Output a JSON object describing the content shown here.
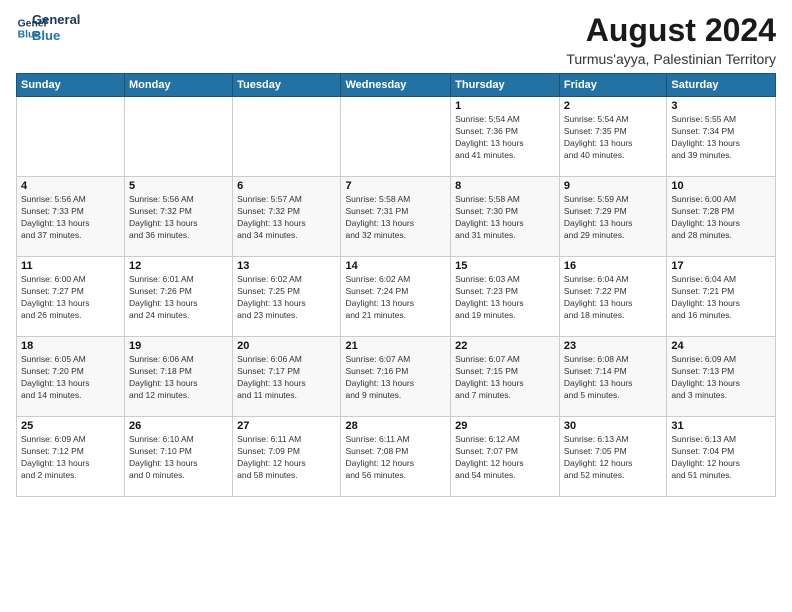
{
  "header": {
    "logo_line1": "General",
    "logo_line2": "Blue",
    "main_title": "August 2024",
    "subtitle": "Turmus'ayya, Palestinian Territory"
  },
  "weekdays": [
    "Sunday",
    "Monday",
    "Tuesday",
    "Wednesday",
    "Thursday",
    "Friday",
    "Saturday"
  ],
  "weeks": [
    [
      {
        "day": "",
        "info": ""
      },
      {
        "day": "",
        "info": ""
      },
      {
        "day": "",
        "info": ""
      },
      {
        "day": "",
        "info": ""
      },
      {
        "day": "1",
        "info": "Sunrise: 5:54 AM\nSunset: 7:36 PM\nDaylight: 13 hours\nand 41 minutes."
      },
      {
        "day": "2",
        "info": "Sunrise: 5:54 AM\nSunset: 7:35 PM\nDaylight: 13 hours\nand 40 minutes."
      },
      {
        "day": "3",
        "info": "Sunrise: 5:55 AM\nSunset: 7:34 PM\nDaylight: 13 hours\nand 39 minutes."
      }
    ],
    [
      {
        "day": "4",
        "info": "Sunrise: 5:56 AM\nSunset: 7:33 PM\nDaylight: 13 hours\nand 37 minutes."
      },
      {
        "day": "5",
        "info": "Sunrise: 5:56 AM\nSunset: 7:32 PM\nDaylight: 13 hours\nand 36 minutes."
      },
      {
        "day": "6",
        "info": "Sunrise: 5:57 AM\nSunset: 7:32 PM\nDaylight: 13 hours\nand 34 minutes."
      },
      {
        "day": "7",
        "info": "Sunrise: 5:58 AM\nSunset: 7:31 PM\nDaylight: 13 hours\nand 32 minutes."
      },
      {
        "day": "8",
        "info": "Sunrise: 5:58 AM\nSunset: 7:30 PM\nDaylight: 13 hours\nand 31 minutes."
      },
      {
        "day": "9",
        "info": "Sunrise: 5:59 AM\nSunset: 7:29 PM\nDaylight: 13 hours\nand 29 minutes."
      },
      {
        "day": "10",
        "info": "Sunrise: 6:00 AM\nSunset: 7:28 PM\nDaylight: 13 hours\nand 28 minutes."
      }
    ],
    [
      {
        "day": "11",
        "info": "Sunrise: 6:00 AM\nSunset: 7:27 PM\nDaylight: 13 hours\nand 26 minutes."
      },
      {
        "day": "12",
        "info": "Sunrise: 6:01 AM\nSunset: 7:26 PM\nDaylight: 13 hours\nand 24 minutes."
      },
      {
        "day": "13",
        "info": "Sunrise: 6:02 AM\nSunset: 7:25 PM\nDaylight: 13 hours\nand 23 minutes."
      },
      {
        "day": "14",
        "info": "Sunrise: 6:02 AM\nSunset: 7:24 PM\nDaylight: 13 hours\nand 21 minutes."
      },
      {
        "day": "15",
        "info": "Sunrise: 6:03 AM\nSunset: 7:23 PM\nDaylight: 13 hours\nand 19 minutes."
      },
      {
        "day": "16",
        "info": "Sunrise: 6:04 AM\nSunset: 7:22 PM\nDaylight: 13 hours\nand 18 minutes."
      },
      {
        "day": "17",
        "info": "Sunrise: 6:04 AM\nSunset: 7:21 PM\nDaylight: 13 hours\nand 16 minutes."
      }
    ],
    [
      {
        "day": "18",
        "info": "Sunrise: 6:05 AM\nSunset: 7:20 PM\nDaylight: 13 hours\nand 14 minutes."
      },
      {
        "day": "19",
        "info": "Sunrise: 6:06 AM\nSunset: 7:18 PM\nDaylight: 13 hours\nand 12 minutes."
      },
      {
        "day": "20",
        "info": "Sunrise: 6:06 AM\nSunset: 7:17 PM\nDaylight: 13 hours\nand 11 minutes."
      },
      {
        "day": "21",
        "info": "Sunrise: 6:07 AM\nSunset: 7:16 PM\nDaylight: 13 hours\nand 9 minutes."
      },
      {
        "day": "22",
        "info": "Sunrise: 6:07 AM\nSunset: 7:15 PM\nDaylight: 13 hours\nand 7 minutes."
      },
      {
        "day": "23",
        "info": "Sunrise: 6:08 AM\nSunset: 7:14 PM\nDaylight: 13 hours\nand 5 minutes."
      },
      {
        "day": "24",
        "info": "Sunrise: 6:09 AM\nSunset: 7:13 PM\nDaylight: 13 hours\nand 3 minutes."
      }
    ],
    [
      {
        "day": "25",
        "info": "Sunrise: 6:09 AM\nSunset: 7:12 PM\nDaylight: 13 hours\nand 2 minutes."
      },
      {
        "day": "26",
        "info": "Sunrise: 6:10 AM\nSunset: 7:10 PM\nDaylight: 13 hours\nand 0 minutes."
      },
      {
        "day": "27",
        "info": "Sunrise: 6:11 AM\nSunset: 7:09 PM\nDaylight: 12 hours\nand 58 minutes."
      },
      {
        "day": "28",
        "info": "Sunrise: 6:11 AM\nSunset: 7:08 PM\nDaylight: 12 hours\nand 56 minutes."
      },
      {
        "day": "29",
        "info": "Sunrise: 6:12 AM\nSunset: 7:07 PM\nDaylight: 12 hours\nand 54 minutes."
      },
      {
        "day": "30",
        "info": "Sunrise: 6:13 AM\nSunset: 7:05 PM\nDaylight: 12 hours\nand 52 minutes."
      },
      {
        "day": "31",
        "info": "Sunrise: 6:13 AM\nSunset: 7:04 PM\nDaylight: 12 hours\nand 51 minutes."
      }
    ]
  ]
}
